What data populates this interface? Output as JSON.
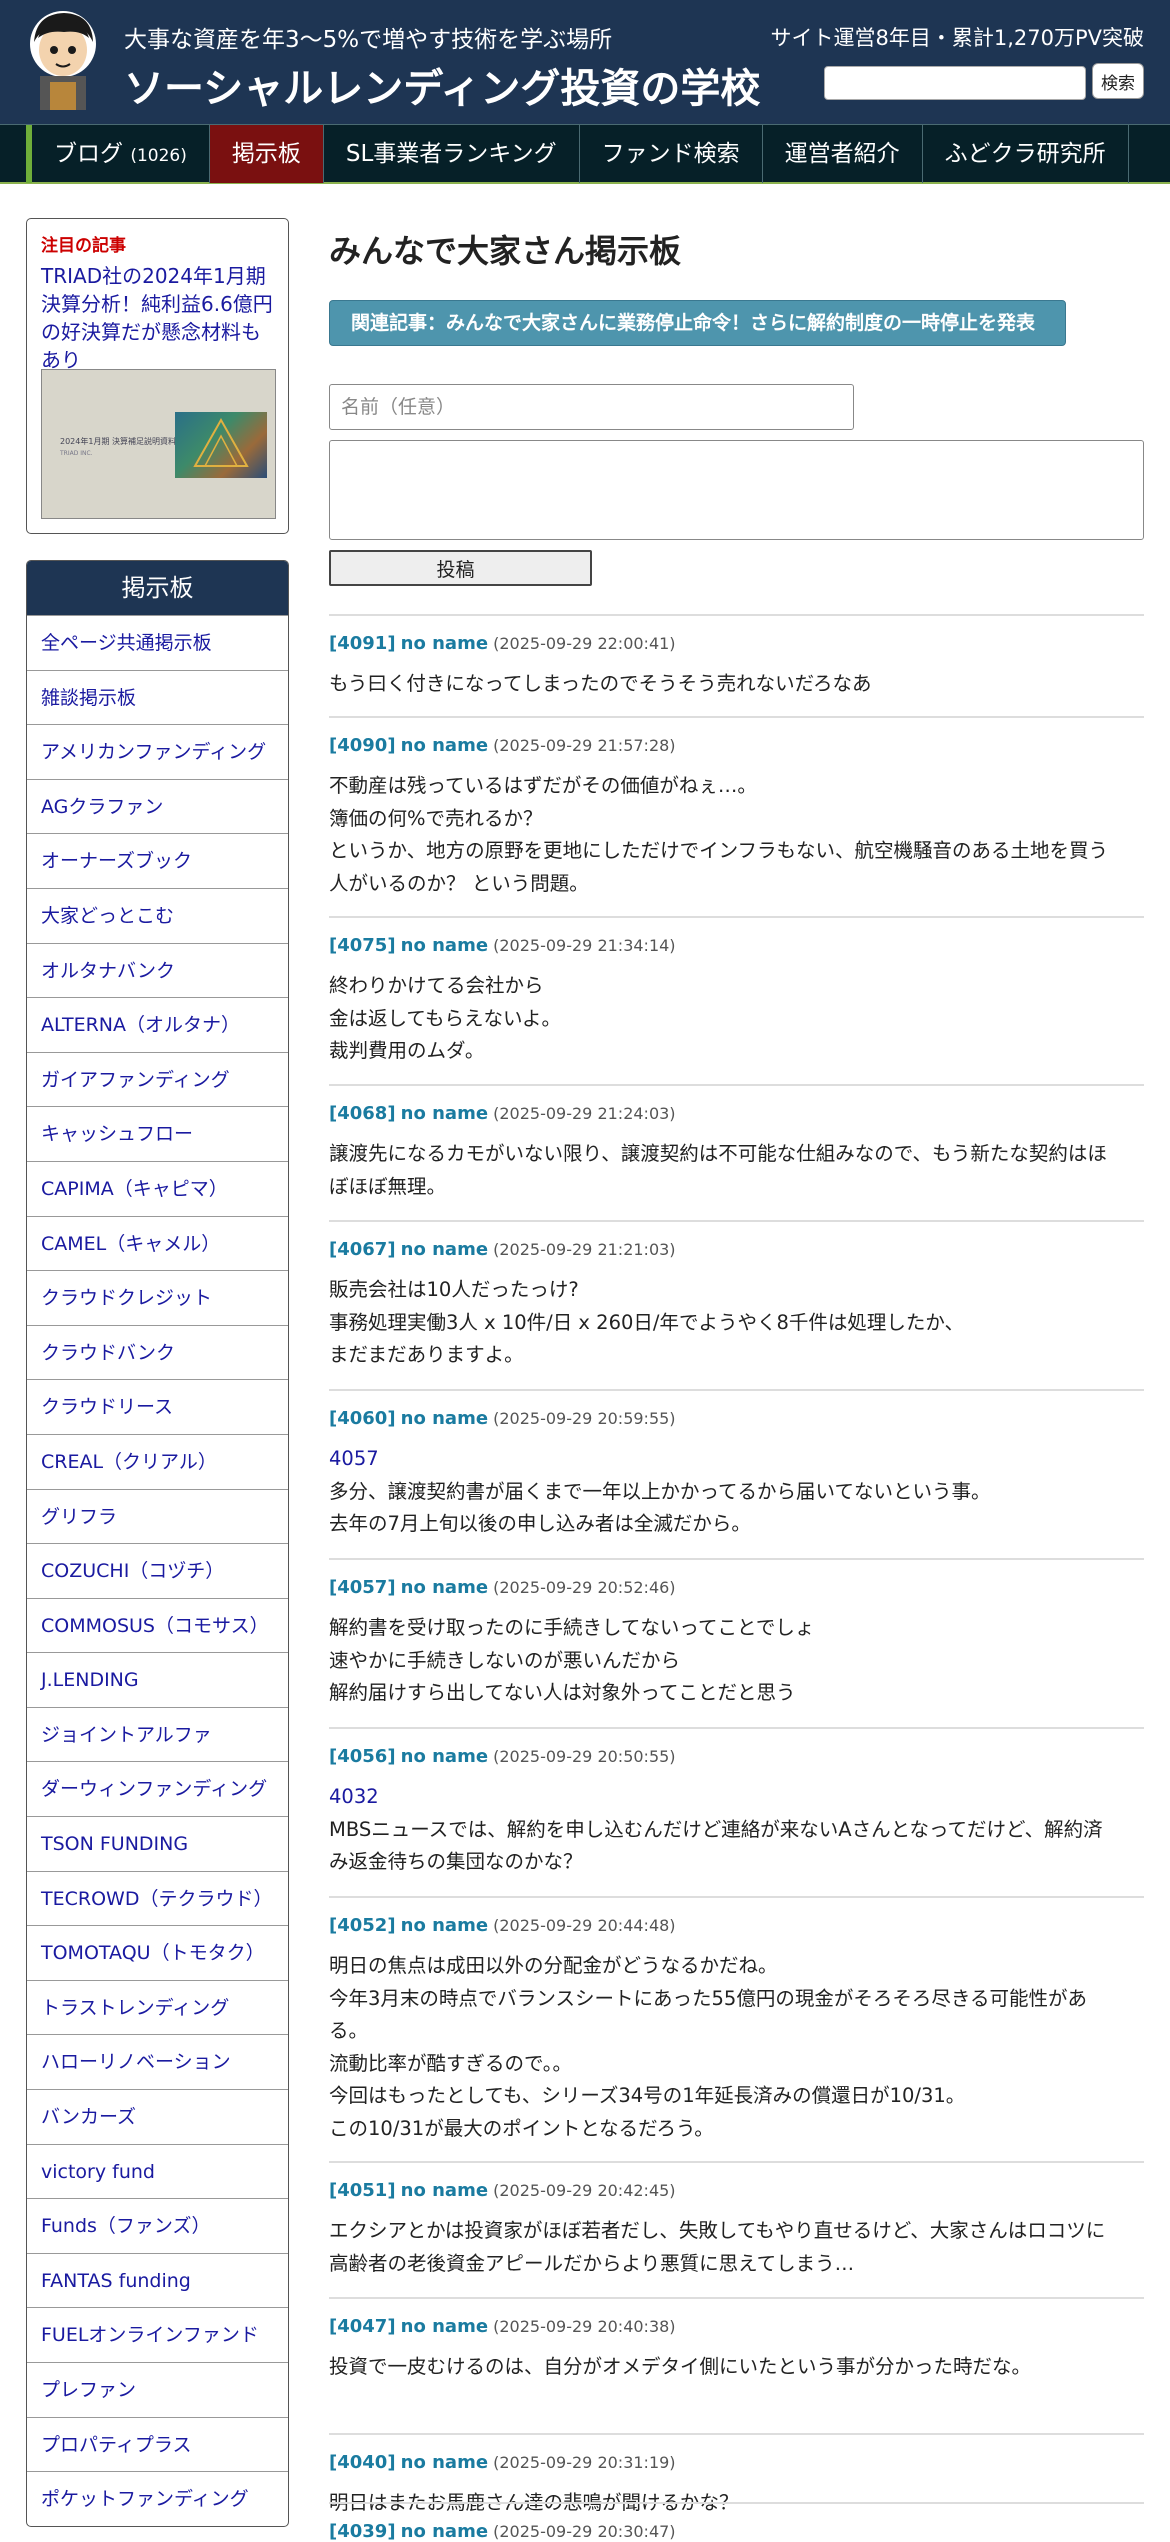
{
  "header": {
    "tagline": "大事な資産を年3〜5%で増やす技術を学ぶ場所",
    "site_title": "ソーシャルレンディング投資の学校",
    "stats": "サイト運営8年目・累計1,270万PV突破",
    "search_placeholder": "",
    "search_button": "検索",
    "logo_icon": "character-mascot-icon"
  },
  "nav": {
    "items": [
      {
        "label": "ブログ",
        "count": "(1026)"
      },
      {
        "label": "掲示板"
      },
      {
        "label": "SL事業者ランキング"
      },
      {
        "label": "ファンド検索"
      },
      {
        "label": "運営者紹介"
      },
      {
        "label": "ふどクラ研究所"
      }
    ],
    "active_index": 1
  },
  "sidebar": {
    "featured": {
      "heading": "注目の記事",
      "title": "TRIAD社の2024年1月期決算分析！純利益6.6億円の好決算だが懸念材料もあり",
      "thumb_text": "2024年1月期 決算補足説明資料",
      "thumb_sub": "TRIAD INC."
    },
    "board_nav": {
      "header": "掲示板",
      "items": [
        "全ページ共通掲示板",
        "雑談掲示板",
        "アメリカンファンディング",
        "AGクラファン",
        "オーナーズブック",
        "大家どっとこむ",
        "オルタナバンク",
        "ALTERNA（オルタナ）",
        "ガイアファンディング",
        "キャッシュフロー",
        "CAPIMA（キャピマ）",
        "CAMEL（キャメル）",
        "クラウドクレジット",
        "クラウドバンク",
        "クラウドリース",
        "CREAL（クリアル）",
        "グリフラ",
        "COZUCHI（コヅチ）",
        "COMMOSUS（コモサス）",
        "J.LENDING",
        "ジョイントアルファ",
        "ダーウィンファンディング",
        "TSON FUNDING",
        "TECROWD（テクラウド）",
        "TOMOTAQU（トモタク）",
        "トラストレンディング",
        "ハローリノベーション",
        "バンカーズ",
        "victory fund",
        "Funds（ファンズ）",
        "FANTAS funding",
        "FUELオンラインファンド",
        "プレファン",
        "プロパティプラス",
        "ポケットファンディング"
      ]
    }
  },
  "main": {
    "title": "みんなで大家さん掲示板",
    "related_link": "関連記事：みんなで大家さんに業務停止命令！さらに解約制度の一時停止を発表",
    "form": {
      "name_placeholder": "名前（任意）",
      "body_value": "",
      "submit_label": "投稿"
    },
    "posts": [
      {
        "no": "[4091]",
        "name": "no name",
        "date": "(2025-09-29 22:00:41)",
        "lines": [
          "もう曰く付きになってしまったのでそうそう売れないだろなあ"
        ]
      },
      {
        "no": "[4090]",
        "name": "no name",
        "date": "(2025-09-29 21:57:28)",
        "lines": [
          "不動産は残っているはずだがその価値がねぇ…。",
          "簿価の何%で売れるか？",
          "というか、地方の原野を更地にしただけでインフラもない、航空機騒音のある土地を買う",
          "人がいるのか？ という問題。"
        ]
      },
      {
        "no": "[4075]",
        "name": "no name",
        "date": "(2025-09-29 21:34:14)",
        "lines": [
          "終わりかけてる会社から",
          "金は返してもらえないよ。",
          "裁判費用のムダ。"
        ]
      },
      {
        "no": "[4068]",
        "name": "no name",
        "date": "(2025-09-29 21:24:03)",
        "lines": [
          "譲渡先になるカモがいない限り、譲渡契約は不可能な仕組みなので、もう新たな契約はほ",
          "ぼほぼ無理。"
        ]
      },
      {
        "no": "[4067]",
        "name": "no name",
        "date": "(2025-09-29 21:21:03)",
        "lines": [
          "販売会社は10人だったっけ?",
          "事務処理実働3人 x 10件/日 x 260日/年でようやく8千件は処理したか、",
          "まだまだありますよ。"
        ]
      },
      {
        "no": "[4060]",
        "name": "no name",
        "date": "(2025-09-29 20:59:55)",
        "reply": "4057",
        "lines": [
          "多分、譲渡契約書が届くまで一年以上かかってるから届いてないという事。",
          "去年の7月上旬以後の申し込み者は全滅だから。"
        ]
      },
      {
        "no": "[4057]",
        "name": "no name",
        "date": "(2025-09-29 20:52:46)",
        "lines": [
          "解約書を受け取ったのに手続きしてないってことでしょ",
          "速やかに手続きしないのが悪いんだから",
          "解約届けすら出してない人は対象外ってことだと思う"
        ]
      },
      {
        "no": "[4056]",
        "name": "no name",
        "date": "(2025-09-29 20:50:55)",
        "reply": "4032",
        "lines": [
          "MBSニュースでは、解約を申し込むんだけど連絡が来ないAさんとなってだけど、解約済",
          "み返金待ちの集団なのかな？"
        ]
      },
      {
        "no": "[4052]",
        "name": "no name",
        "date": "(2025-09-29 20:44:48)",
        "lines": [
          "明日の焦点は成田以外の分配金がどうなるかだね。",
          "今年3月末の時点でバランスシートにあった55億円の現金がそろそろ尽きる可能性があ",
          "る。",
          "流動比率が酷すぎるので。。",
          "今回はもったとしても、シリーズ34号の1年延長済みの償還日が10/31。",
          "この10/31が最大のポイントとなるだろう。"
        ]
      },
      {
        "no": "[4051]",
        "name": "no name",
        "date": "(2025-09-29 20:42:45)",
        "lines": [
          "エクシアとかは投資家がほぼ若者だし、失敗してもやり直せるけど、大家さんはロコツに",
          "高齢者の老後資金アピールだからより悪質に思えてしまう…"
        ]
      },
      {
        "no": "[4047]",
        "name": "no name",
        "date": "(2025-09-29 20:40:38)",
        "lines": [
          "投資で一皮むけるのは、自分がオメデタイ側にいたという事が分かった時だな。"
        ]
      },
      {
        "no": "[4040]",
        "name": "no name",
        "date": "(2025-09-29 20:31:19)",
        "lines": [
          "明日はまたお馬鹿さん達の悲鳴が聞けるかな？"
        ]
      },
      {
        "no": "[4039]",
        "name": "no name",
        "date": "(2025-09-29 20:30:47)",
        "lines": []
      }
    ]
  }
}
